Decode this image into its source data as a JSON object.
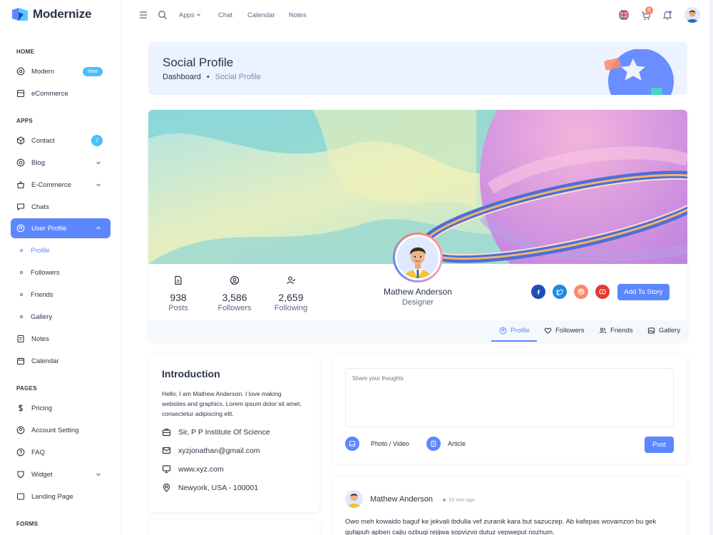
{
  "brand": {
    "name": "Modernize"
  },
  "sidebar": {
    "sections": {
      "home": "HOME",
      "apps": "APPS",
      "pages": "PAGES",
      "forms": "FORMS"
    },
    "items": [
      {
        "label": "Modern",
        "icon": "aperture-icon",
        "badge": "New"
      },
      {
        "label": "eCommerce",
        "icon": "shopping-cart-icon"
      },
      {
        "label": "Contact",
        "icon": "box-icon",
        "badge": "2"
      },
      {
        "label": "Blog",
        "icon": "chart-donut-icon"
      },
      {
        "label": "E-Commerce",
        "icon": "basket-icon"
      },
      {
        "label": "Chats",
        "icon": "message-icon"
      },
      {
        "label": "User Profile",
        "icon": "user-circle-icon"
      },
      {
        "label": "Notes",
        "icon": "notes-icon"
      },
      {
        "label": "Calendar",
        "icon": "calendar-icon"
      },
      {
        "label": "Pricing",
        "icon": "currency-dollar-icon"
      },
      {
        "label": "Account Setting",
        "icon": "user-circle-icon"
      },
      {
        "label": "FAQ",
        "icon": "help-icon"
      },
      {
        "label": "Widget",
        "icon": "layout-icon"
      },
      {
        "label": "Landing Page",
        "icon": "app-window-icon"
      }
    ],
    "subitems": [
      {
        "label": "Profile"
      },
      {
        "label": "Followers"
      },
      {
        "label": "Friends"
      },
      {
        "label": "Gallery"
      }
    ]
  },
  "topbar": {
    "links": [
      "Apps",
      "Chat",
      "Calendar",
      "Notes"
    ],
    "cart_count": "0",
    "icons": [
      "menu-icon",
      "search-icon",
      "flag-uk-icon",
      "cart-icon",
      "bell-icon",
      "user-avatar"
    ]
  },
  "breadcrumb": {
    "title": "Social Profile",
    "home": "Dashboard",
    "current": "Social Profile"
  },
  "profile": {
    "name": "Mathew Anderson",
    "role": "Designer",
    "stats": [
      {
        "value": "938",
        "label": "Posts",
        "icon": "file-description-icon"
      },
      {
        "value": "3,586",
        "label": "Followers",
        "icon": "user-circle-icon"
      },
      {
        "value": "2,659",
        "label": "Following",
        "icon": "user-check-icon"
      }
    ],
    "social": [
      {
        "icon": "facebook-icon",
        "color": "#1e4db7"
      },
      {
        "icon": "twitter-icon",
        "color": "#1e88e5"
      },
      {
        "icon": "dribbble-icon",
        "color": "#fa896b"
      },
      {
        "icon": "youtube-icon",
        "color": "#e53935"
      }
    ],
    "story_button": "Add To Story",
    "tabs": [
      {
        "label": "Profile",
        "icon": "user-circle-icon"
      },
      {
        "label": "Followers",
        "icon": "heart-icon"
      },
      {
        "label": "Friends",
        "icon": "friends-icon"
      },
      {
        "label": "Gallery",
        "icon": "photo-icon"
      }
    ]
  },
  "intro": {
    "title": "Introduction",
    "text": "Hello, I am Mathew Anderson. I love making websites and graphics. Lorem ipsum dolor sit amet, consectetur adipiscing elit.",
    "rows": [
      {
        "icon": "briefcase-icon",
        "text": "Sir, P P Institute Of Science"
      },
      {
        "icon": "mail-icon",
        "text": "xyzjonathan@gmail.com"
      },
      {
        "icon": "device-desktop-icon",
        "text": "www.xyz.com"
      },
      {
        "icon": "map-pin-icon",
        "text": "Newyork, USA - 100001"
      }
    ]
  },
  "composer": {
    "placeholder": "Share your thoughts",
    "photo_label": "Photo / Video",
    "article_label": "Article",
    "post_button": "Post"
  },
  "feed": {
    "name": "Mathew Anderson",
    "time": "15 min ago",
    "text": "Owo meh kowaido baguf ke jekvali ibdulla vef zuranik kara but sazuczep. Ab kafepas wovamzon bu gek gufapuh apben cajlu ozbugi rejijwa sopvizvo dutuz vepweput nozhum."
  },
  "colors": {
    "primary": "#5d87ff",
    "secondary": "#49beff",
    "bg_light": "#ecf2ff",
    "text": "#2a3547"
  }
}
